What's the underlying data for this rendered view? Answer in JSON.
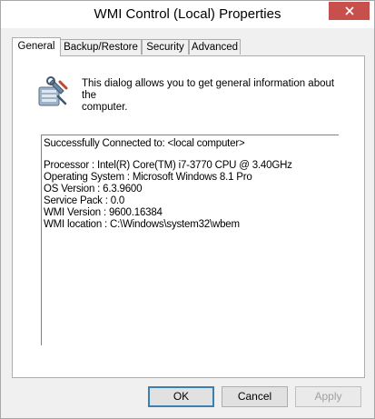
{
  "window": {
    "title": "WMI Control (Local) Properties"
  },
  "tabs": [
    {
      "label": "General",
      "active": true
    },
    {
      "label": "Backup/Restore",
      "active": false
    },
    {
      "label": "Security",
      "active": false
    },
    {
      "label": "Advanced",
      "active": false
    }
  ],
  "general": {
    "icon": "wmi-control-icon",
    "intro_line1": "This dialog allows you to get general information about the",
    "intro_line2": "computer.",
    "info": {
      "connected": "Successfully Connected to:  <local computer>",
      "processor": "Processor :  Intel(R) Core(TM) i7-3770 CPU @ 3.40GHz",
      "os": "Operating System :  Microsoft Windows 8.1 Pro",
      "os_version": "OS Version :  6.3.9600",
      "service_pack": "Service Pack :  0.0",
      "wmi_version": "WMI Version :  9600.16384",
      "wmi_location": "WMI location :  C:\\Windows\\system32\\wbem"
    }
  },
  "buttons": {
    "ok": "OK",
    "cancel": "Cancel",
    "apply": "Apply"
  },
  "colors": {
    "close_button": "#c7504c",
    "default_button_border": "#3c7fb1"
  }
}
